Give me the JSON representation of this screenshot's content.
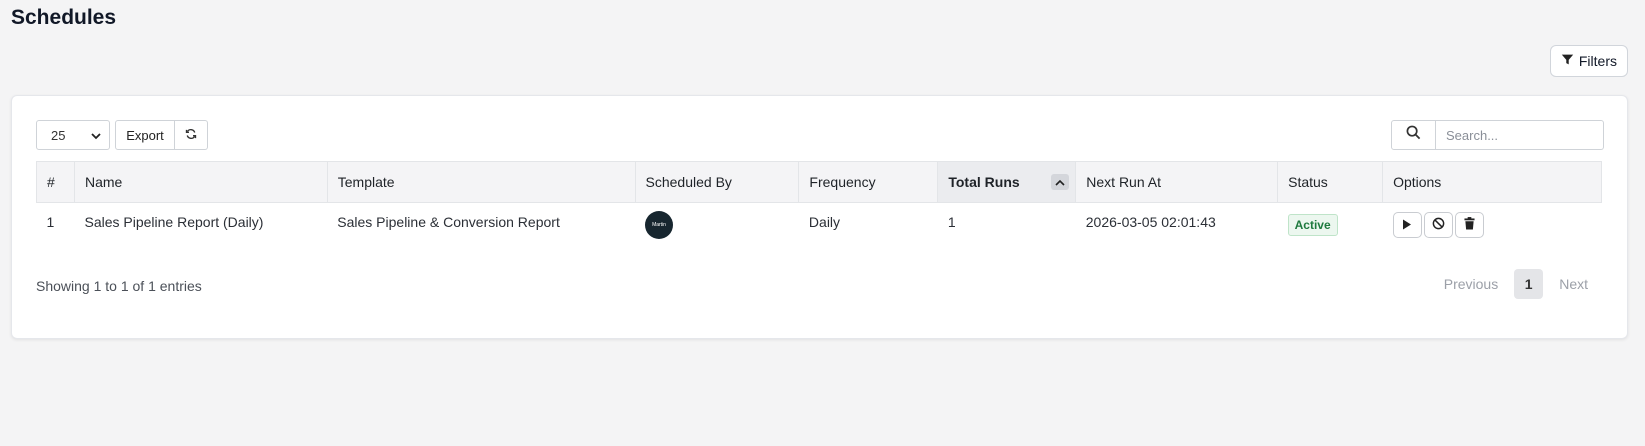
{
  "page": {
    "title": "Schedules"
  },
  "filters": {
    "label": "Filters",
    "icon": "filter-icon"
  },
  "toolbar": {
    "page_length": "25",
    "export_label": "Export",
    "refresh_icon": "refresh-icon"
  },
  "search": {
    "placeholder": "Search...",
    "value": "",
    "icon": "search-icon"
  },
  "table": {
    "columns": [
      "#",
      "Name",
      "Template",
      "Scheduled By",
      "Frequency",
      "Total Runs",
      "Next Run At",
      "Status",
      "Options"
    ],
    "sorted_column": "Total Runs",
    "rows": [
      {
        "index": "1",
        "name": "Sales Pipeline Report (Daily)",
        "template": "Sales Pipeline & Conversion Report",
        "scheduled_by_avatar": "Martin",
        "frequency": "Daily",
        "total_runs": "1",
        "next_run_at": "2026-03-05 02:01:43",
        "status": "Active",
        "options": [
          "play-icon",
          "ban-icon",
          "trash-icon"
        ]
      }
    ]
  },
  "footer": {
    "info": "Showing 1 to 1 of 1 entries",
    "previous": "Previous",
    "current_page": "1",
    "next": "Next"
  },
  "colors": {
    "accent_status": "#1e7a3e",
    "avatar_bg": "#17262f",
    "page_bg": "#f4f4f5"
  }
}
